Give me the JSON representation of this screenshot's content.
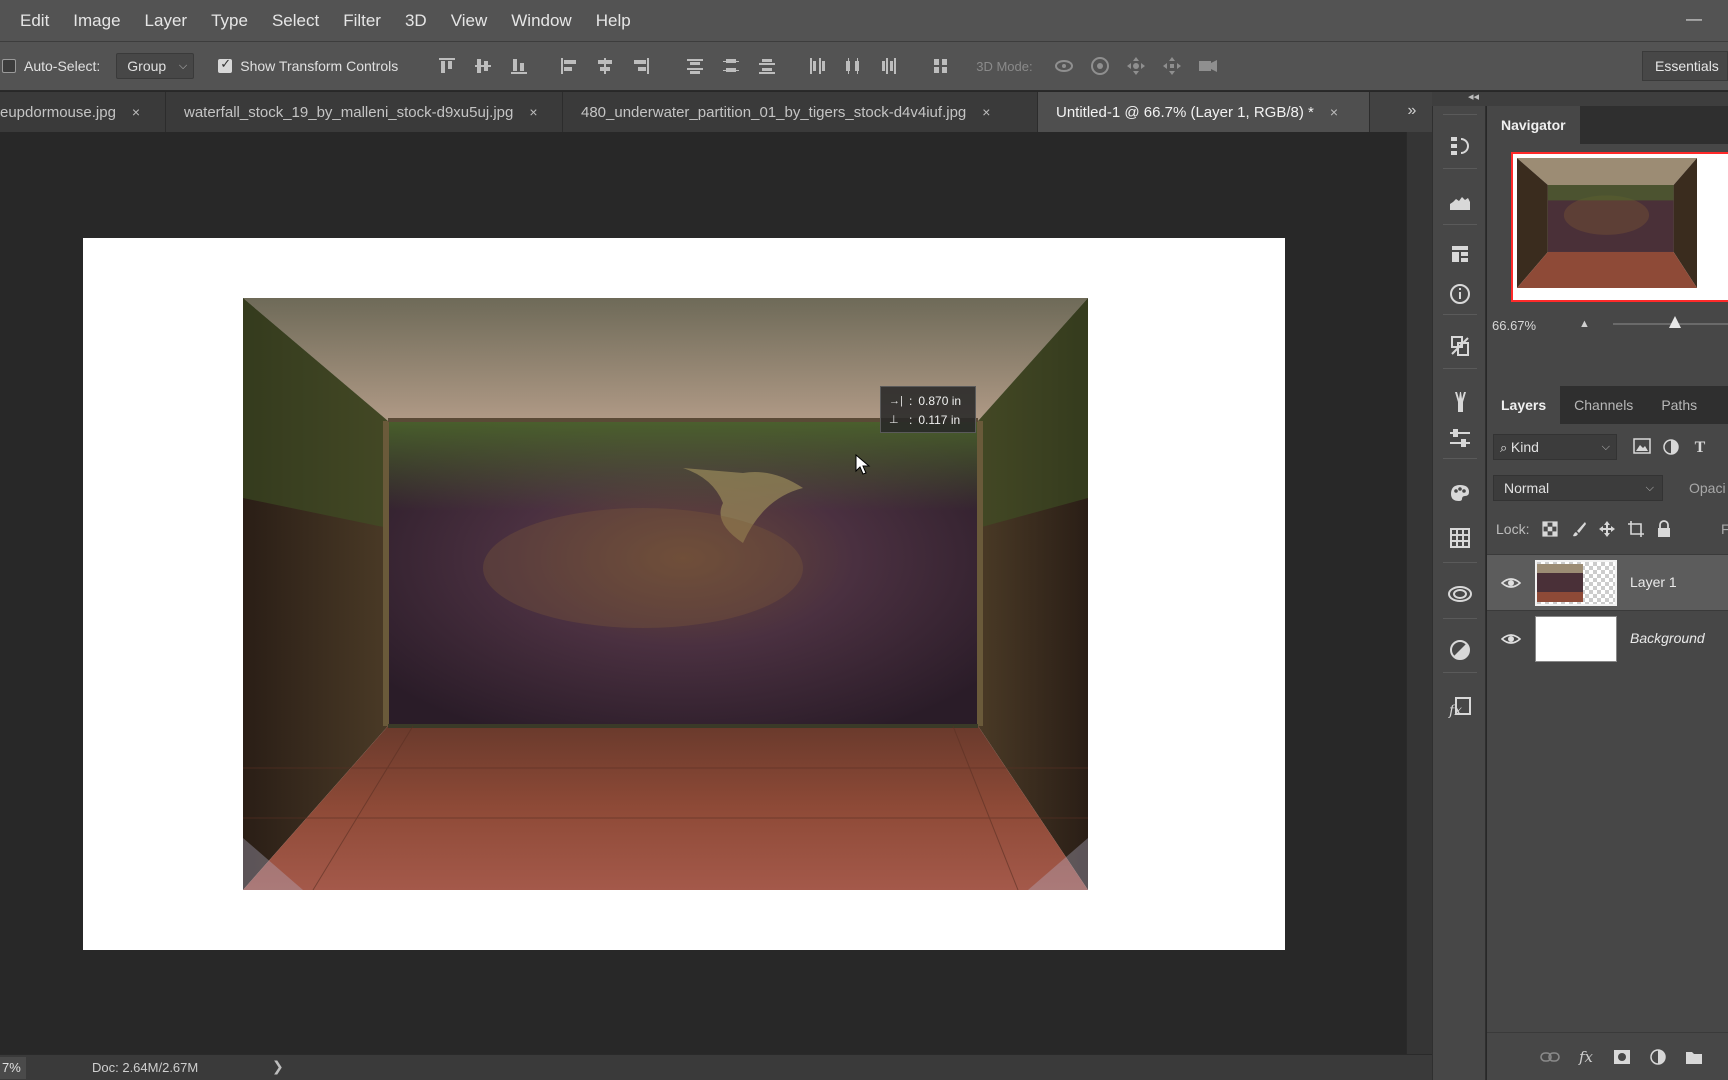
{
  "menu": [
    "Edit",
    "Image",
    "Layer",
    "Type",
    "Select",
    "Filter",
    "3D",
    "View",
    "Window",
    "Help"
  ],
  "options_bar": {
    "auto_select_label": "Auto-Select:",
    "auto_select_checked": false,
    "auto_select_target": "Group",
    "show_transform_label": "Show Transform Controls",
    "show_transform_checked": true,
    "mode_3d_label": "3D Mode:",
    "workspace": "Essentials"
  },
  "doc_tabs": [
    {
      "title": "eupdormouse.jpg",
      "close": "×",
      "active": false
    },
    {
      "title": "waterfall_stock_19_by_malleni_stock-d9xu5uj.jpg",
      "close": "×",
      "active": false
    },
    {
      "title": "480_underwater_partition_01_by_tigers_stock-d4v4iuf.jpg",
      "close": "×",
      "active": false
    },
    {
      "title": "Untitled-1 @ 66.7% (Layer 1, RGB/8) *",
      "close": "×",
      "active": true
    }
  ],
  "tabs_overflow": "»",
  "canvas_hud": {
    "dx": "0.870 in",
    "dy": "0.117 in",
    "dx_icon": "→|",
    "dy_icon": "⊥"
  },
  "status_bar": {
    "zoom": "7%",
    "doc": "Doc: 2.64M/2.67M",
    "arrow": "❯"
  },
  "collapse_arrows": "◂◂",
  "navigator": {
    "tab": "Navigator",
    "zoom": "66.67%",
    "zoom_slider_fraction": 0.52
  },
  "layers_panel": {
    "tabs": [
      "Layers",
      "Channels",
      "Paths"
    ],
    "active_tab": "Layers",
    "kind_filter": "Kind",
    "blend_mode": "Normal",
    "opacity_label": "Opaci",
    "lock_label": "Lock:",
    "fill_label": "F",
    "layers": [
      {
        "name": "Layer 1",
        "visible": true,
        "selected": true
      },
      {
        "name": "Background",
        "visible": true,
        "selected": false
      }
    ]
  },
  "icons": {
    "strip": [
      "history-icon",
      "histogram-icon",
      "properties-icon",
      "info-icon",
      "clone-source-icon",
      "brush-icon",
      "adjustments-icon",
      "swatches-icon",
      "grid-icon",
      "libraries-icon",
      "color-icon",
      "styles-icon"
    ],
    "footer": [
      "link-icon",
      "fx-icon",
      "mask-icon",
      "adjustment-layer-icon",
      "group-folder-icon"
    ]
  },
  "colors": {
    "chrome": "#535353",
    "canvas_bg": "#282828",
    "panel": "#474747",
    "navigator_frame": "#ff2a2a"
  }
}
